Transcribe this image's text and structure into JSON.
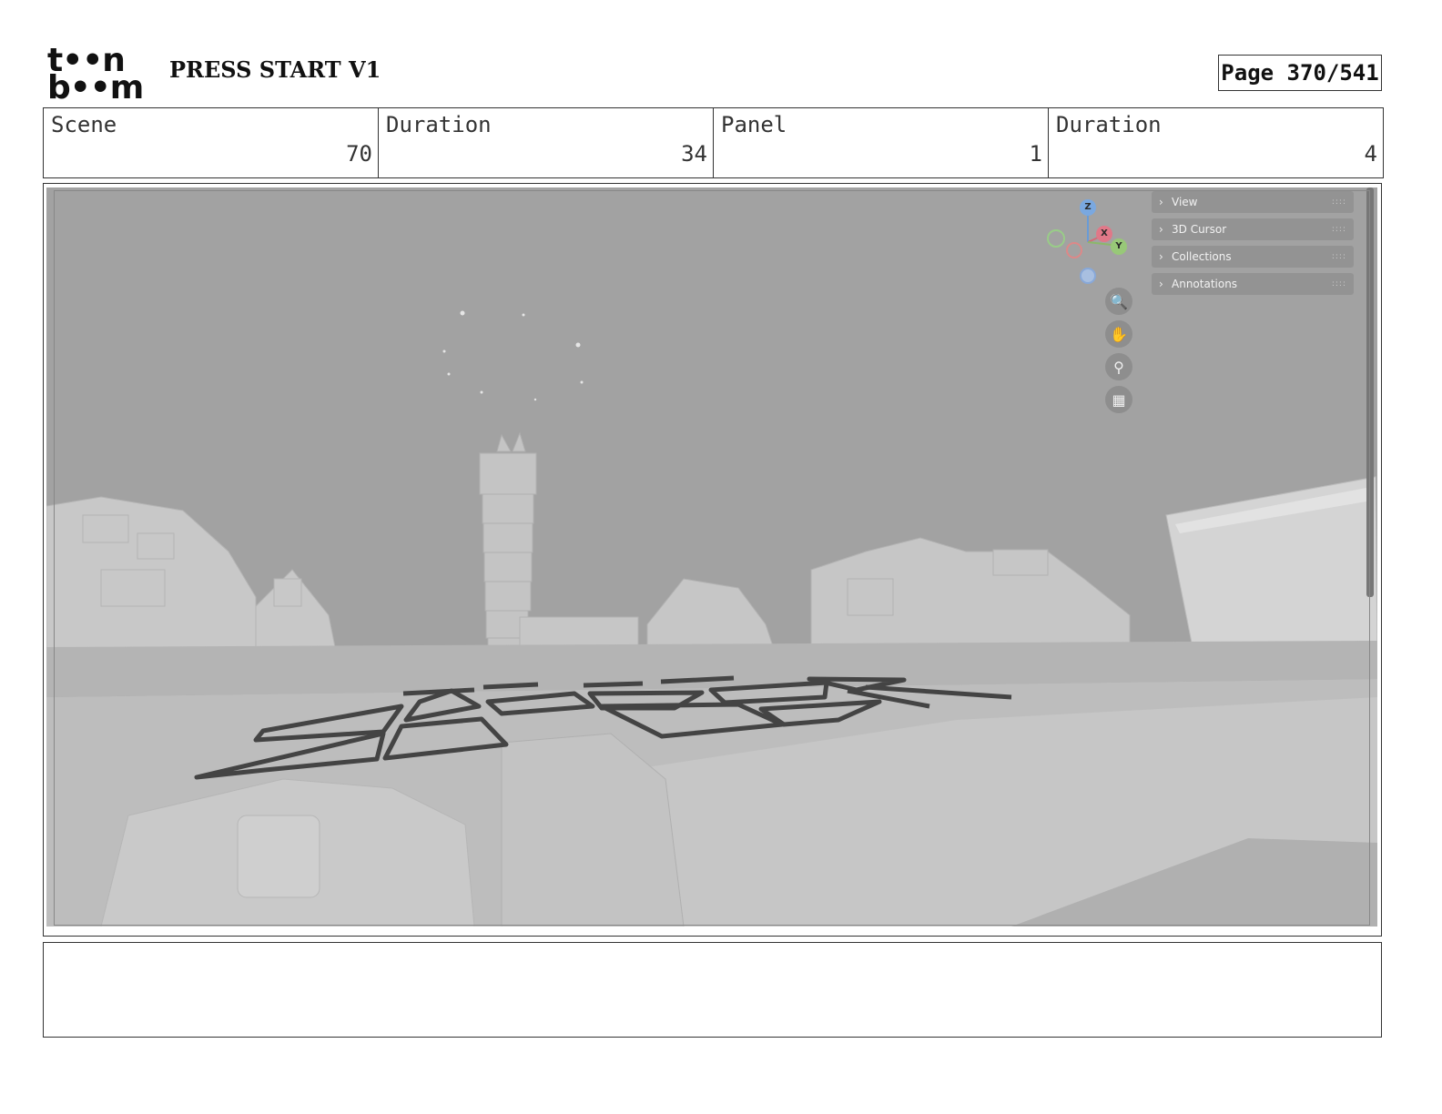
{
  "header": {
    "logo_line1": "t••n",
    "logo_line2": "b••m",
    "doc_title": "PRESS START V1",
    "page_label": "Page 370/541"
  },
  "info": [
    {
      "label": "Scene",
      "value": "70"
    },
    {
      "label": "Duration",
      "value": "34"
    },
    {
      "label": "Panel",
      "value": "1"
    },
    {
      "label": "Duration",
      "value": "4"
    }
  ],
  "viewport": {
    "n_panel": [
      "View",
      "3D Cursor",
      "Collections",
      "Annotations"
    ],
    "gizmo": {
      "z": "Z",
      "x": "X",
      "y": "Y"
    },
    "nav_icons": [
      "zoom-icon",
      "hand-icon",
      "camera-icon",
      "grid-icon"
    ]
  },
  "notes": ""
}
